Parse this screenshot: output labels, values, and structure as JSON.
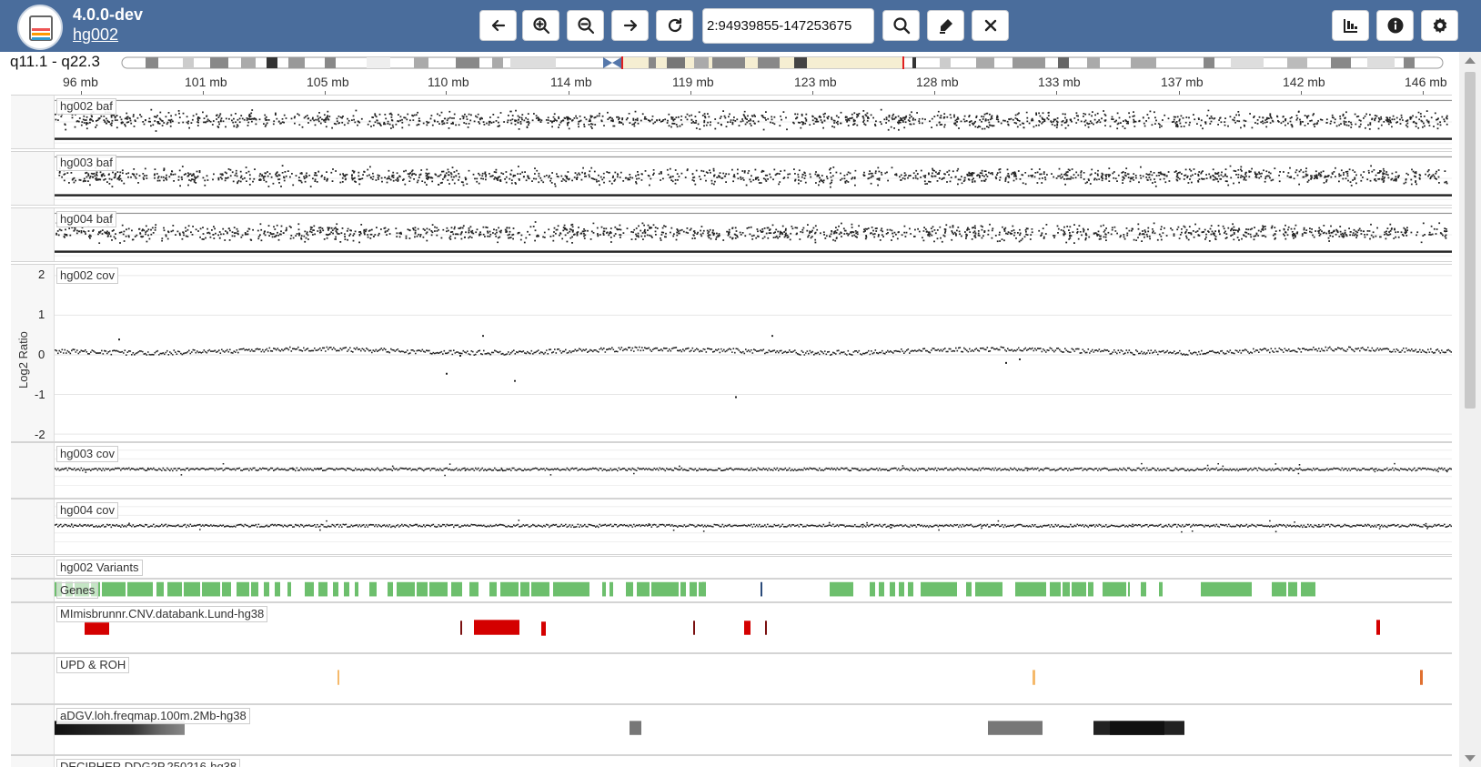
{
  "header": {
    "version": "4.0.0-dev",
    "case_name": "hg002",
    "region": "2:94939855-147253675",
    "buttons": {
      "pan_left": "arrow-left-icon",
      "zoom_in": "zoom-in-icon",
      "zoom_out": "zoom-out-icon",
      "pan_right": "arrow-right-icon",
      "reset": "refresh-icon",
      "search": "search-icon",
      "marker": "marker-icon",
      "clear": "close-icon",
      "chart": "bar-chart-icon",
      "info": "info-icon",
      "settings": "gear-icon"
    }
  },
  "chromosome": {
    "band_range": "q11.1 - q22.3"
  },
  "ruler": {
    "ticks": [
      "96 mb",
      "101 mb",
      "105 mb",
      "110 mb",
      "114 mb",
      "119 mb",
      "123 mb",
      "128 mb",
      "133 mb",
      "137 mb",
      "142 mb",
      "146 mb"
    ]
  },
  "tracks": {
    "baf": [
      {
        "label": "hg002 baf"
      },
      {
        "label": "hg003 baf"
      },
      {
        "label": "hg004 baf"
      }
    ],
    "cov_main": {
      "label": "hg002 cov",
      "axis_title": "Log2 Ratio",
      "axis_ticks": [
        "2",
        "1",
        "0",
        "-1",
        "-2"
      ]
    },
    "cov_other": [
      {
        "label": "hg003 cov"
      },
      {
        "label": "hg004 cov"
      }
    ],
    "variants": {
      "label": "hg002 Variants"
    },
    "genes": {
      "label": "Genes"
    },
    "cnv": {
      "label": "MImisbrunnr.CNV.databank.Lund-hg38"
    },
    "upd": {
      "label": "UPD & ROH"
    },
    "loh": {
      "label": "aDGV.loh.freqmap.100m.2Mb-hg38"
    },
    "decipher": {
      "label": "DECIPHER.DDG2P.250216-hg38"
    }
  },
  "colors": {
    "header_bg": "#4a6d9c",
    "gene": "#6dbf6d",
    "cnv_red": "#d40000",
    "cnv_dark": "#7a1010",
    "upd_orange": "#f5b96b",
    "roh_orange": "#e07030",
    "ideogram_highlight": "#f5eed2",
    "ideogram_marker": "#e02020"
  }
}
